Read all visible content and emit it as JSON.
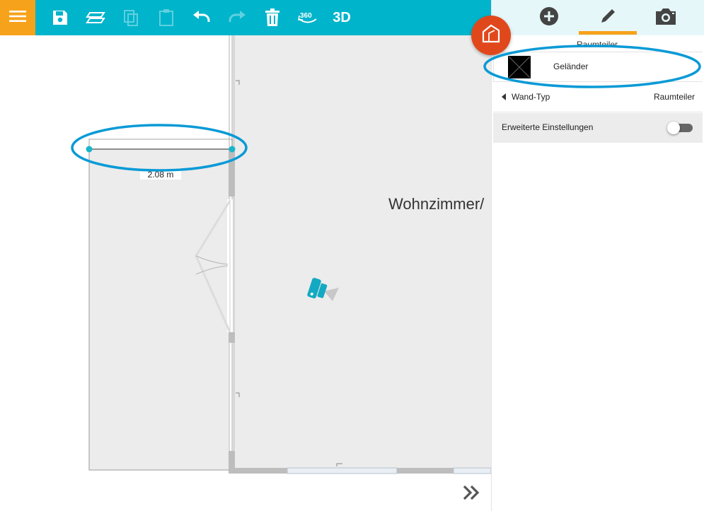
{
  "toolbar": {
    "menu_icon": "hamburger-menu-icon",
    "save_icon": "save-icon",
    "layers_icon": "layers-icon",
    "copy_icon": "copy-icon",
    "paste_icon": "paste-icon",
    "undo_icon": "undo-icon",
    "redo_icon": "redo-icon",
    "delete_icon": "trash-icon",
    "view360_label": "360",
    "view3d_label": "3D"
  },
  "canvas": {
    "dimension_label": "2.08 m",
    "room_label": "Wohnzimmer/",
    "camera_icon": "camera-marker-icon",
    "more_icon": "double-chevron-right-icon"
  },
  "panel": {
    "tabs": [
      {
        "icon": "plus-circle-icon",
        "name": "add"
      },
      {
        "icon": "pencil-icon",
        "name": "edit"
      },
      {
        "icon": "camera-icon",
        "name": "snapshot"
      }
    ],
    "subtitle": "Raumteiler",
    "type_label": "Geländer",
    "wand_typ_label": "Wand-Typ",
    "wand_typ_value": "Raumteiler",
    "advanced_label": "Erweiterte Einstellungen",
    "advanced_enabled": false
  },
  "colors": {
    "toolbar": "#00b4cb",
    "menu_button": "#f7a21b",
    "tab_active_underline": "#f7a21b",
    "house_button": "#e0481c",
    "highlight_ring": "#0a9ad6"
  }
}
